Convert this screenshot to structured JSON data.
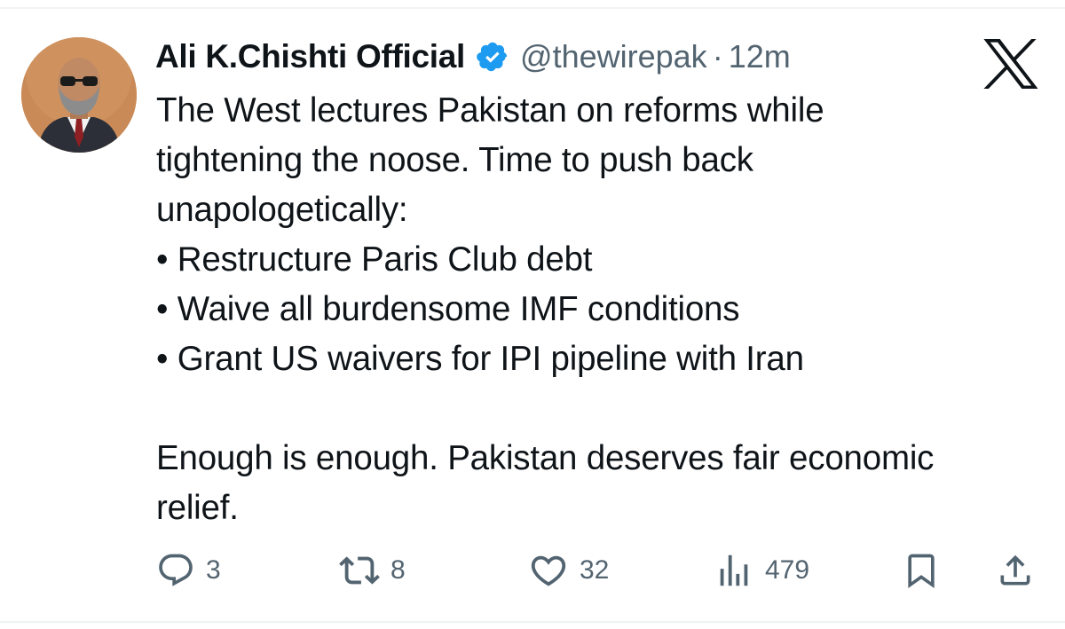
{
  "tweet": {
    "author": {
      "display_name": "Ali K.Chishti Official",
      "handle": "@thewirepak",
      "verified": true
    },
    "separator": "·",
    "time": "12m",
    "platform_icon": "x-logo-icon",
    "text_lines": [
      "The West lectures Pakistan on reforms while",
      "tightening the noose. Time to push back",
      "unapologetically:",
      "• Restructure Paris Club debt",
      "• Waive all burdensome IMF conditions",
      "• Grant US waivers for IPI pipeline with Iran",
      "",
      "Enough is enough. Pakistan deserves fair economic",
      "relief."
    ]
  },
  "actions": {
    "replies": {
      "icon": "reply-icon",
      "count": "3"
    },
    "reposts": {
      "icon": "repost-icon",
      "count": "8"
    },
    "likes": {
      "icon": "heart-icon",
      "count": "32"
    },
    "views": {
      "icon": "views-icon",
      "count": "479"
    },
    "bookmark": {
      "icon": "bookmark-icon"
    },
    "share": {
      "icon": "share-icon"
    }
  },
  "colors": {
    "text": "#0f1419",
    "secondary": "#536471",
    "verified_blue": "#1d9bf0",
    "border": "#eff3f4"
  }
}
